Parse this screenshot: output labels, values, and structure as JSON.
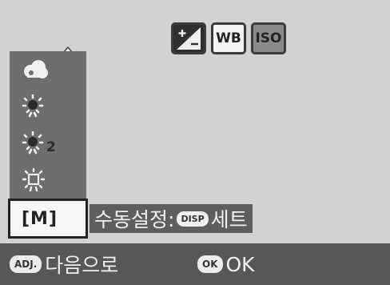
{
  "top_icons": [
    {
      "name": "exposure-compensation-icon"
    },
    {
      "label": "WB"
    },
    {
      "label": "ISO"
    }
  ],
  "menu": {
    "items": [
      {
        "icon": "cloud-icon"
      },
      {
        "icon": "incandescent-icon"
      },
      {
        "icon": "fluorescent-2-icon",
        "suffix": "2"
      },
      {
        "icon": "fluorescent-icon"
      },
      {
        "label": "[M]",
        "selected": true
      }
    ]
  },
  "hint": {
    "text": "수동설정:",
    "button": "DISP",
    "action": "세트"
  },
  "bottom": {
    "adj_button": "ADJ.",
    "adj_text": "다음으로",
    "ok_button": "OK",
    "ok_text": "OK"
  }
}
